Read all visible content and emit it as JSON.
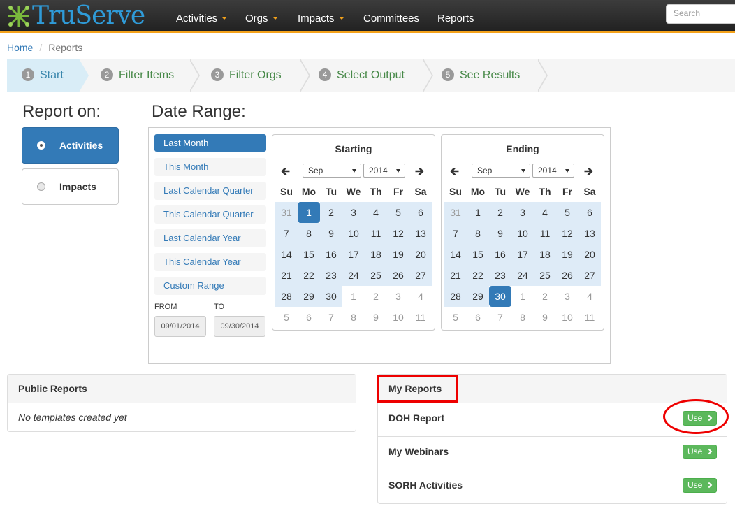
{
  "brand": {
    "name": "TruServe"
  },
  "nav": {
    "items": [
      {
        "label": "Activities",
        "dropdown": true
      },
      {
        "label": "Orgs",
        "dropdown": true
      },
      {
        "label": "Impacts",
        "dropdown": true
      },
      {
        "label": "Committees",
        "dropdown": false
      },
      {
        "label": "Reports",
        "dropdown": false
      }
    ],
    "search_placeholder": "Search"
  },
  "breadcrumb": {
    "home": "Home",
    "current": "Reports"
  },
  "wizard": {
    "steps": [
      {
        "num": "1",
        "label": "Start",
        "active": true
      },
      {
        "num": "2",
        "label": "Filter Items"
      },
      {
        "num": "3",
        "label": "Filter Orgs"
      },
      {
        "num": "4",
        "label": "Select Output"
      },
      {
        "num": "5",
        "label": "See Results"
      }
    ]
  },
  "report_on": {
    "title": "Report on:",
    "options": [
      {
        "label": "Activities",
        "selected": true
      },
      {
        "label": "Impacts",
        "selected": false
      }
    ]
  },
  "date_range": {
    "title": "Date Range:",
    "ranges": [
      "Last Month",
      "This Month",
      "Last Calendar Quarter",
      "This Calendar Quarter",
      "Last Calendar Year",
      "This Calendar Year",
      "Custom Range"
    ],
    "selected_range": "Last Month",
    "from_label": "FROM",
    "to_label": "TO",
    "from_value": "09/01/2014",
    "to_value": "09/30/2014"
  },
  "calendars": {
    "weekdays": [
      "Su",
      "Mo",
      "Tu",
      "We",
      "Th",
      "Fr",
      "Sa"
    ],
    "starting": {
      "title": "Starting",
      "month": "Sep",
      "year": "2014"
    },
    "ending": {
      "title": "Ending",
      "month": "Sep",
      "year": "2014"
    },
    "days": [
      "31",
      "1",
      "2",
      "3",
      "4",
      "5",
      "6",
      "7",
      "8",
      "9",
      "10",
      "11",
      "12",
      "13",
      "14",
      "15",
      "16",
      "17",
      "18",
      "19",
      "20",
      "21",
      "22",
      "23",
      "24",
      "25",
      "26",
      "27",
      "28",
      "29",
      "30",
      "1",
      "2",
      "3",
      "4",
      "5",
      "6",
      "7",
      "8",
      "9",
      "10",
      "11"
    ]
  },
  "public_reports": {
    "title": "Public Reports",
    "empty": "No templates created yet"
  },
  "my_reports": {
    "title": "My Reports",
    "use_label": "Use",
    "items": [
      "DOH Report",
      "My Webinars",
      "SORH Activities"
    ]
  },
  "colors": {
    "brand_blue": "#337ab7",
    "nav_accent": "#f4a21a",
    "success": "#5cb85c",
    "annotation": "#e00000"
  }
}
